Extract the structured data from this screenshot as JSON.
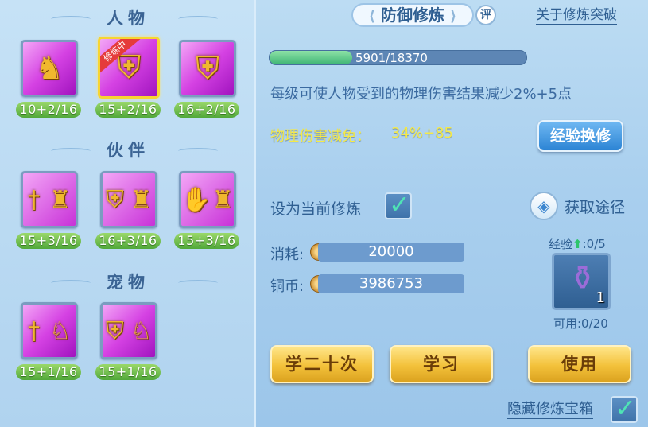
{
  "left": {
    "sections": [
      {
        "title": "人物",
        "skills": [
          {
            "icon": "warrior-meditate-icon",
            "level": "10+2/16",
            "active": false
          },
          {
            "icon": "armor-icon",
            "level": "15+2/16",
            "active": true,
            "ribbon": "修炼中"
          },
          {
            "icon": "armor-icon",
            "level": "16+2/16",
            "active": false
          }
        ]
      },
      {
        "title": "伙伴",
        "skills": [
          {
            "icon": "sword-tiger-icon",
            "level": "15+3/16"
          },
          {
            "icon": "shield-tiger-icon",
            "level": "16+3/16"
          },
          {
            "icon": "claw-tiger-icon",
            "level": "15+3/16"
          }
        ]
      },
      {
        "title": "宠物",
        "skills": [
          {
            "icon": "sword-cat-icon",
            "level": "15+1/16"
          },
          {
            "icon": "shield-cat-icon",
            "level": "15+1/16"
          }
        ]
      }
    ]
  },
  "right": {
    "title": "防御修炼",
    "review_badge": "评",
    "link": "关于修炼突破",
    "progress": {
      "text": "5901/18370",
      "current": 5901,
      "max": 18370
    },
    "description": "每级可使人物受到的物理伤害结果减少2%+5点",
    "reduction_label": "物理伤害减免：",
    "reduction_value": "34%+85",
    "exchange_button": "经验换修",
    "set_current_label": "设为当前修炼",
    "source_label": "获取途径",
    "cost_label": "消耗:",
    "cost_value": "20000",
    "coins_label": "铜币:",
    "coins_value": "3986753",
    "exp_label": "经验",
    "exp_value": ":0/5",
    "item_count": "1",
    "available": "可用:0/20",
    "btn_learn20": "学二十次",
    "btn_learn": "学习",
    "btn_use": "使用",
    "hide_label": "隐藏修炼宝箱"
  },
  "colors": {
    "accent_blue": "#2c84d4",
    "gold": "#f3c13a",
    "progress_green": "#3fb575",
    "highlight_yellow": "#f4e94a"
  }
}
